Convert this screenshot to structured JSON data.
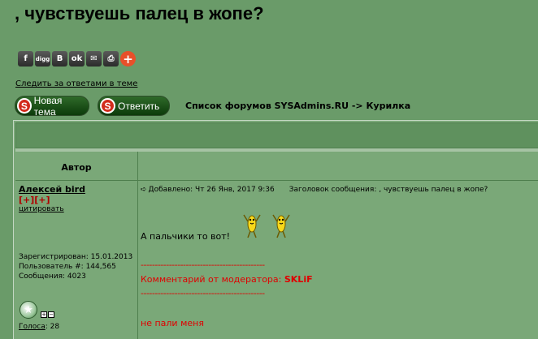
{
  "topic": {
    "title": ", чувствуешь палец в жопе?"
  },
  "share": {
    "buttons": [
      {
        "icon": "facebook-icon",
        "glyph": "f"
      },
      {
        "icon": "digg-icon",
        "glyph": "digg"
      },
      {
        "icon": "vkontakte-icon",
        "glyph": "B"
      },
      {
        "icon": "odnoklassniki-icon",
        "glyph": "ok"
      },
      {
        "icon": "email-icon",
        "glyph": "✉"
      },
      {
        "icon": "print-icon",
        "glyph": "⎙"
      },
      {
        "icon": "more-plus-icon",
        "glyph": "+"
      }
    ]
  },
  "follow_link": "Следить за ответами в теме",
  "actions": {
    "new_topic": "Новая тема",
    "reply": "Ответить",
    "icon_letter": "S"
  },
  "breadcrumb": "Список форумов SYSAdmins.RU -> Курилка",
  "table": {
    "author_header": "Автор"
  },
  "post": {
    "author": {
      "name": "Алексей bird",
      "karma": "[+][+]",
      "quote": "цитировать",
      "registered": "Зарегистрирован: 15.01.2013",
      "user_no": "Пользователь #: 144,565",
      "messages": "Сообщения: 4023",
      "votes_label": "Голоса",
      "votes_value": ": 28"
    },
    "added": "Добавлено: Чт 26 Янв, 2017 9:36",
    "subject": "Заголовок сообщения: , чувствуешь палец в жопе?",
    "body": "А пальчики то вот!",
    "mod_separator": "--------------------------------------------",
    "mod_label": "Комментарий от модератора:",
    "mod_name": "SKLiF",
    "mod_text": "не пали меня"
  },
  "colors": {
    "background": "#6a9b69",
    "mod_red": "#e00000",
    "karma_red": "#b00000"
  }
}
